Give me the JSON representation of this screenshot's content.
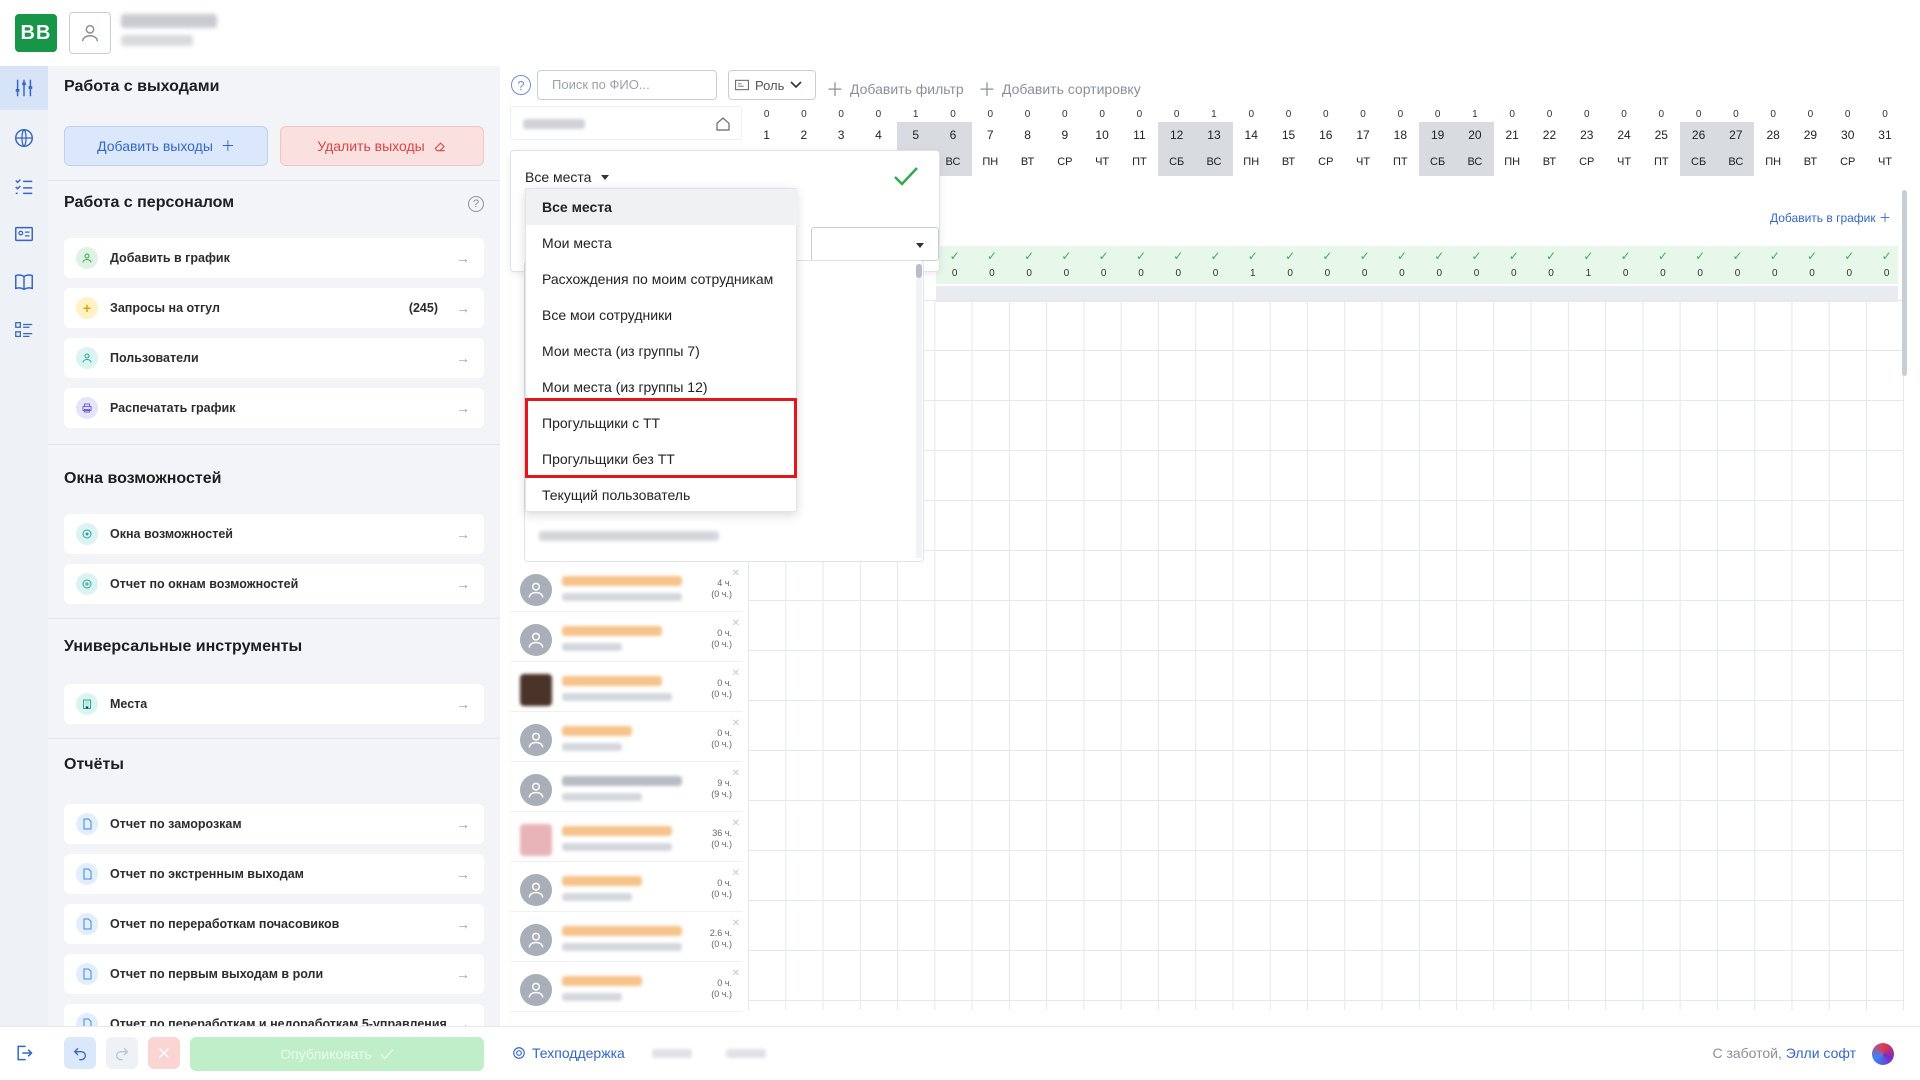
{
  "header": {
    "logo_text": "ВВ"
  },
  "sidebar": {
    "sections": {
      "shifts_title": "Работа с выходами",
      "add_shifts": "Добавить выходы",
      "delete_shifts": "Удалить выходы",
      "personnel_title": "Работа с персоналом",
      "opportunities_title": "Окна возможностей",
      "tools_title": "Универсальные инструменты",
      "reports_title": "Отчёты"
    },
    "personnel_items": [
      {
        "label": "Добавить в график"
      },
      {
        "label": "Запросы на отгул",
        "count": "(245)"
      },
      {
        "label": "Пользователи"
      },
      {
        "label": "Распечатать график"
      }
    ],
    "opportunity_items": [
      {
        "label": "Окна возможностей"
      },
      {
        "label": "Отчет по окнам возможностей"
      }
    ],
    "tool_items": [
      {
        "label": "Места"
      }
    ],
    "report_items": [
      {
        "label": "Отчет по заморозкам"
      },
      {
        "label": "Отчет по экстренным выходам"
      },
      {
        "label": "Отчет по переработкам почасовиков"
      },
      {
        "label": "Отчет по первым выходам в роли"
      },
      {
        "label": "Отчет по переработкам и недоработкам 5-управления"
      }
    ]
  },
  "toolbar": {
    "help": "?",
    "search_placeholder": "Поиск по ФИО...",
    "role_label": "Роль",
    "add_filter": "Добавить фильтр",
    "add_sort": "Добавить сортировку"
  },
  "filter_popup": {
    "title": "Все места"
  },
  "dropdown": {
    "options": [
      "Все места",
      "Мои места",
      "Расхождения по моим сотрудникам",
      "Все мои сотрудники",
      "Мои места (из группы 7)",
      "Мои места (из группы 12)",
      "Прогульщики с ТТ",
      "Прогульщики без ТТ",
      "Текущий пользователь"
    ],
    "selected": "Все места"
  },
  "calendar": {
    "days": [
      "1",
      "2",
      "3",
      "4",
      "5",
      "6",
      "7",
      "8",
      "9",
      "10",
      "11",
      "12",
      "13",
      "14",
      "15",
      "16",
      "17",
      "18",
      "19",
      "20",
      "21",
      "22",
      "23",
      "24",
      "25",
      "26",
      "27",
      "28",
      "29",
      "30",
      "31"
    ],
    "weekdays": [
      "",
      "",
      "",
      "",
      "",
      "ВС",
      "ПН",
      "ВТ",
      "СР",
      "ЧТ",
      "ПТ",
      "СБ",
      "ВС",
      "ПН",
      "ВТ",
      "СР",
      "ЧТ",
      "ПТ",
      "СБ",
      "ВС",
      "ПН",
      "ВТ",
      "СР",
      "ЧТ",
      "ПТ",
      "СБ",
      "ВС",
      "ПН",
      "ВТ",
      "СР",
      "ЧТ"
    ],
    "counts": [
      "0",
      "0",
      "0",
      "0",
      "1",
      "0",
      "0",
      "0",
      "0",
      "0",
      "0",
      "0",
      "1",
      "0",
      "0",
      "0",
      "0",
      "0",
      "0",
      "1",
      "0",
      "0",
      "0",
      "0",
      "0",
      "0",
      "0",
      "0",
      "0",
      "0",
      "0"
    ],
    "weekend_days": [
      5,
      6,
      12,
      13,
      19,
      20,
      26,
      27
    ],
    "check_counts": [
      "0",
      "0",
      "0",
      "0",
      "0",
      "0",
      "0",
      "0",
      "1",
      "0",
      "0",
      "0",
      "0",
      "0",
      "0",
      "0",
      "0",
      "1",
      "0",
      "0",
      "0",
      "0",
      "0",
      "0",
      "0",
      "0"
    ],
    "add_to_schedule": "Добавить в график"
  },
  "employees": [
    {
      "hours": "4 ч.",
      "hours_sub": "(0 ч.)"
    },
    {
      "hours": "0 ч.",
      "hours_sub": "(0 ч.)"
    },
    {
      "hours": "0 ч.",
      "hours_sub": "(0 ч.)"
    },
    {
      "hours": "0 ч.",
      "hours_sub": "(0 ч.)"
    },
    {
      "hours": "9 ч.",
      "hours_sub": "(9 ч.)"
    },
    {
      "hours": "36 ч.",
      "hours_sub": "(0 ч.)"
    },
    {
      "hours": "0 ч.",
      "hours_sub": "(0 ч.)"
    },
    {
      "hours": "2.6 ч.",
      "hours_sub": "(0 ч.)"
    },
    {
      "hours": "0 ч.",
      "hours_sub": "(0 ч.)"
    }
  ],
  "footer": {
    "publish": "Опубликовать",
    "support": "Техподдержка",
    "care_prefix": "С заботой,",
    "care_brand": "Элли софт"
  },
  "colors": {
    "brand": "#17964a",
    "accent": "#3567c2",
    "danger": "#d64545",
    "highlight": "#e3161b"
  }
}
